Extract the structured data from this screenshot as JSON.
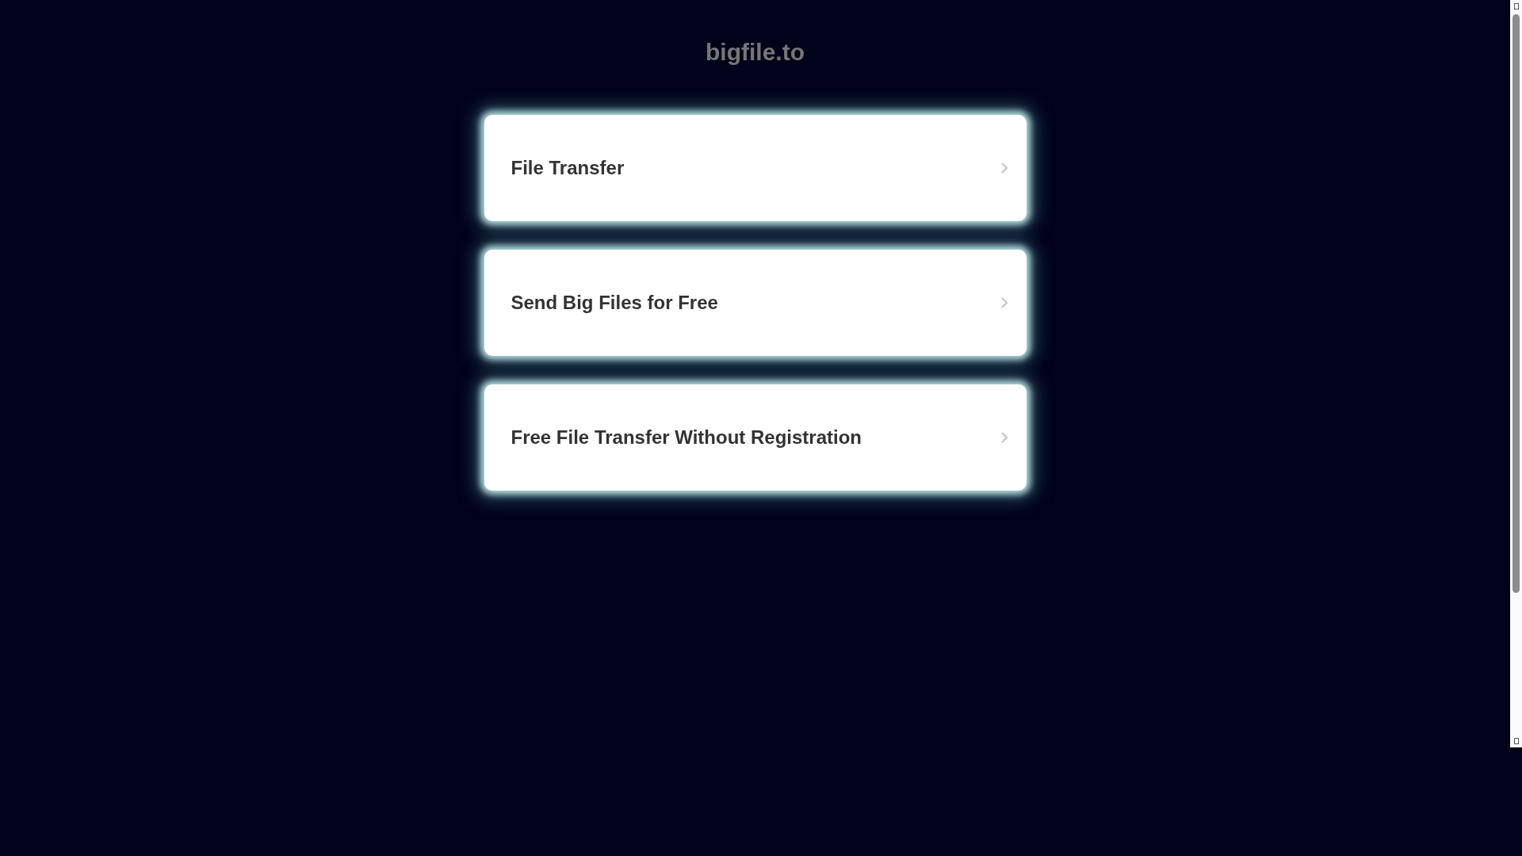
{
  "site_title": "bigfile.to",
  "links": [
    {
      "label": "File Transfer"
    },
    {
      "label": "Send Big Files for Free"
    },
    {
      "label": "Free File Transfer Without Registration"
    }
  ]
}
